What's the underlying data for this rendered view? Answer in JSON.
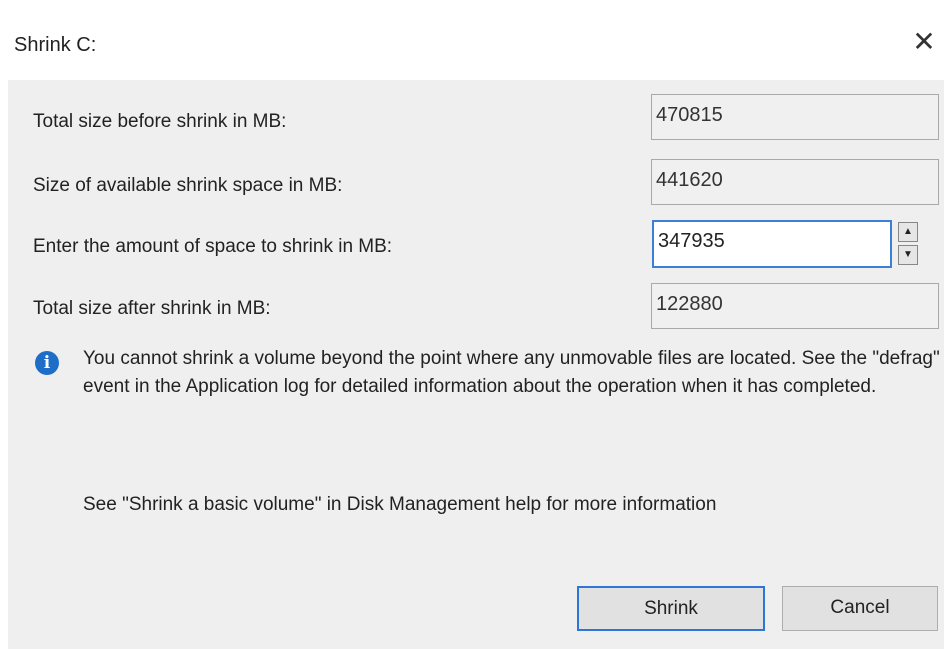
{
  "dialog": {
    "title": "Shrink C:",
    "close_glyph": "✕"
  },
  "fields": {
    "total_before_label": "Total size before shrink in MB:",
    "total_before_value": "470815",
    "available_label": "Size of available shrink space in MB:",
    "available_value": "441620",
    "amount_label": "Enter the amount of space to shrink in MB:",
    "amount_value": "347935",
    "total_after_label": "Total size after shrink in MB:",
    "total_after_value": "122880"
  },
  "spinner": {
    "up_glyph": "▲",
    "down_glyph": "▼"
  },
  "info": {
    "icon": "i",
    "message": "You cannot shrink a volume beyond the point where any unmovable files are located. See the \"defrag\" event in the Application log for detailed information about the operation when it has completed."
  },
  "help_text": "See \"Shrink a basic volume\" in Disk Management help for more information",
  "buttons": {
    "shrink": "Shrink",
    "cancel": "Cancel"
  },
  "colors": {
    "accent": "#2e75d8",
    "info_icon": "#1e6ec8",
    "dialog_bg": "#efefef"
  }
}
